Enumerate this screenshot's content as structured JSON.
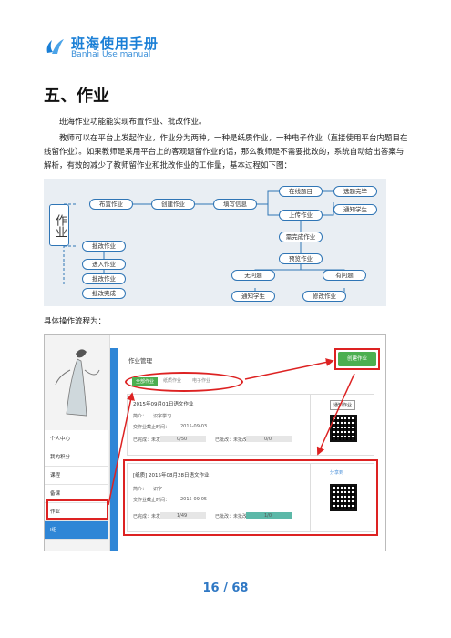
{
  "header": {
    "logo_cn": "班海使用手册",
    "logo_en": "Banhai Use manual"
  },
  "section_title": "五、作业",
  "paragraphs": [
    "班海作业功能能实现布置作业、批改作业。",
    "教师可以在平台上发起作业，作业分为两种，一种是纸质作业，一种电子作业（直接使用平台内题目在线留作业）。如果教师是采用平台上的客观题留作业的话，那么教师是不需要批改的，系统自动给出答案与解析，有效的减少了教师留作业和批改作业的工作量，基本过程如下图："
  ],
  "flow": {
    "root": "作业",
    "top_row": [
      "布置作业",
      "创建作业",
      "填写信息"
    ],
    "branch_upper": [
      "在线题目",
      "选题完毕",
      "通知学生"
    ],
    "branch_lower": [
      "上传作业",
      "需完成作业",
      "预览作业"
    ],
    "left_column": [
      "批改作业",
      "进入作业",
      "批改作业",
      "批改完成"
    ],
    "outcomes": [
      "无问题",
      "有问题",
      "通知学生",
      "修改作业"
    ]
  },
  "caption": "具体操作流程为：",
  "screenshot": {
    "panel_title": "作业管理",
    "create_button": "创建作业",
    "tabs": [
      "全部作业",
      "纸质作业",
      "电子作业"
    ],
    "sidebar": [
      "个人中心",
      "我的积分",
      "课程",
      "备课",
      "作业",
      "I组"
    ],
    "cards": [
      {
        "title": "2015年09月01日语文作业",
        "intro_label": "简介：",
        "intro": "识字学习",
        "deadline_label": "交作业截止时间：",
        "deadline": "2015-09-03",
        "done_label": "已完成：未发",
        "done": "0/50",
        "graded_label": "已批改：未批改",
        "graded": "0/0",
        "action": "通知作业"
      },
      {
        "title": "[纸质] 2015年08月28日语文作业",
        "intro_label": "简介：",
        "intro": "识字",
        "deadline_label": "交作业截止时间：",
        "deadline": "2015-09-05",
        "done_label": "已完成：未发",
        "done": "1/49",
        "graded_label": "已批改：未批改",
        "graded": "1/0",
        "action": "分享到"
      }
    ]
  },
  "page_number": "16 / 68"
}
